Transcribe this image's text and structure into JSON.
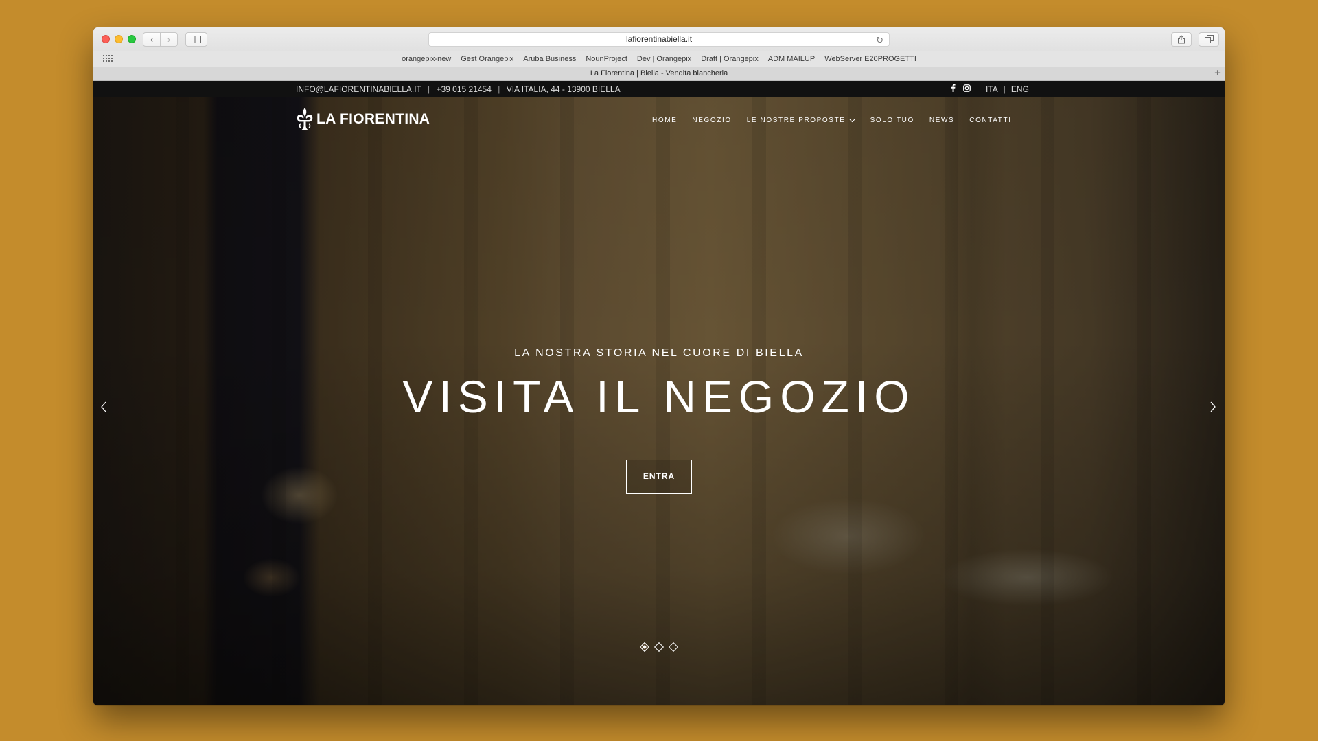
{
  "browser": {
    "url": "lafiorentinabiella.it",
    "bookmarks": [
      "orangepix-new",
      "Gest Orangepix",
      "Aruba Business",
      "NounProject",
      "Dev | Orangepix",
      "Draft | Orangepix",
      "ADM MAILUP",
      "WebServer E20PROGETTI"
    ],
    "tab_title": "La Fiorentina | Biella - Vendita biancheria",
    "icons": {
      "back": "chevron-left-icon",
      "forward": "chevron-right-icon",
      "sidebar": "sidebar-icon",
      "reload": "reload-icon",
      "share": "share-icon",
      "tabs": "tabs-icon",
      "new_tab": "plus-icon",
      "top_sites": "grid-icon"
    }
  },
  "topbar": {
    "email": "INFO@LAFIORENTINABIELLA.IT",
    "phone": "+39 015 21454",
    "address": "VIA ITALIA, 44 - 13900 BIELLA",
    "separator": "|",
    "social": [
      "facebook-icon",
      "instagram-icon"
    ],
    "lang_ita": "ITA",
    "lang_eng": "ENG"
  },
  "site": {
    "logo_text": "LA FIORENTINA",
    "nav": [
      {
        "label": "HOME"
      },
      {
        "label": "NEGOZIO"
      },
      {
        "label": "LE NOSTRE PROPOSTE"
      },
      {
        "label": "SOLO TUO"
      },
      {
        "label": "NEWS"
      },
      {
        "label": "CONTATTI"
      }
    ]
  },
  "hero": {
    "subtitle": "LA NOSTRA STORIA NEL CUORE DI BIELLA",
    "title": "VISITA IL NEGOZIO",
    "cta": "ENTRA",
    "slides_total": 3,
    "active_slide": 1
  },
  "colors": {
    "desktop_background": "#c48c2c",
    "topbar": "#111111",
    "text": "#ffffff"
  }
}
